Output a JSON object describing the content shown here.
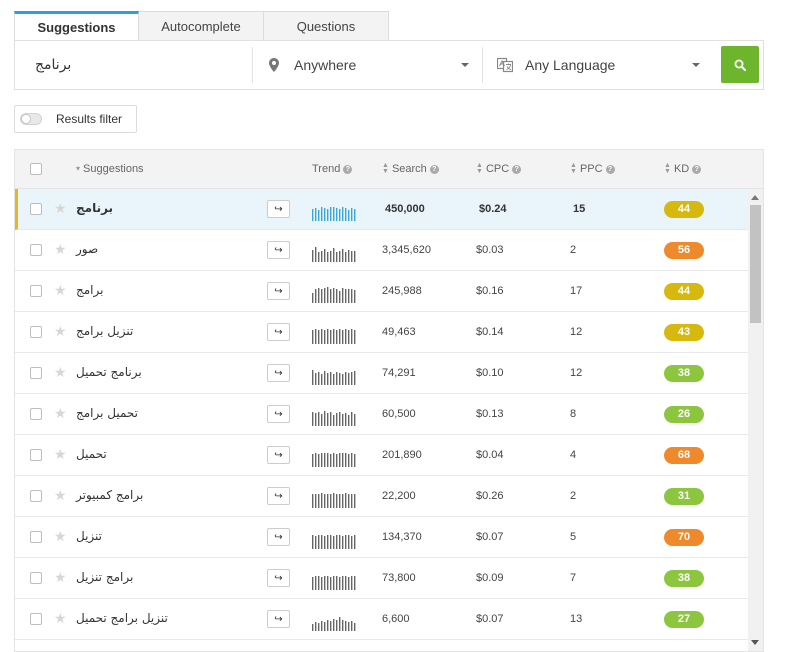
{
  "tabs": [
    {
      "label": "Suggestions",
      "active": true
    },
    {
      "label": "Autocomplete",
      "active": false
    },
    {
      "label": "Questions",
      "active": false
    }
  ],
  "search": {
    "keyword": "برنامج",
    "location": "Anywhere",
    "language": "Any Language",
    "submit_icon": "search-icon"
  },
  "filter": {
    "label": "Results filter",
    "enabled": false
  },
  "table": {
    "headers": {
      "keyword": "Suggestions",
      "trend": "Trend",
      "search": "Search",
      "cpc": "CPC",
      "ppc": "PPC",
      "kd": "KD"
    },
    "rows": [
      {
        "keyword": "برنامج",
        "search": "450,000",
        "cpc": "$0.24",
        "ppc": "15",
        "kd": "44",
        "kd_color": "#d7b80f",
        "selected": true,
        "trend_color": "#3aa7d9",
        "trend": [
          0.75,
          0.8,
          0.7,
          0.85,
          0.8,
          0.75,
          0.9,
          0.85,
          0.8,
          0.75,
          0.85,
          0.8,
          0.7,
          0.8,
          0.75
        ]
      },
      {
        "keyword": "صور",
        "search": "3,345,620",
        "cpc": "$0.03",
        "ppc": "2",
        "kd": "56",
        "kd_color": "#ee8a2c",
        "selected": false,
        "trend_color": "#666666",
        "trend": [
          0.75,
          0.95,
          0.6,
          0.7,
          0.8,
          0.65,
          0.7,
          0.85,
          0.65,
          0.7,
          0.8,
          0.6,
          0.75,
          0.7,
          0.7
        ]
      },
      {
        "keyword": "برامج",
        "search": "245,988",
        "cpc": "$0.16",
        "ppc": "17",
        "kd": "44",
        "kd_color": "#d7b80f",
        "selected": false,
        "trend_color": "#666666",
        "trend": [
          0.6,
          0.85,
          0.95,
          0.9,
          0.95,
          1.0,
          0.85,
          0.95,
          0.9,
          0.75,
          0.95,
          0.9,
          0.85,
          0.9,
          0.8
        ]
      },
      {
        "keyword": "تنزيل برامج",
        "search": "49,463",
        "cpc": "$0.14",
        "ppc": "12",
        "kd": "43",
        "kd_color": "#d7b80f",
        "selected": false,
        "trend_color": "#666666",
        "trend": [
          0.9,
          0.95,
          0.9,
          0.95,
          0.9,
          0.95,
          0.9,
          0.95,
          0.9,
          0.95,
          0.9,
          0.95,
          0.9,
          0.95,
          0.9
        ]
      },
      {
        "keyword": "برنامج تحميل",
        "search": "74,291",
        "cpc": "$0.10",
        "ppc": "12",
        "kd": "38",
        "kd_color": "#8cc63f",
        "selected": false,
        "trend_color": "#666666",
        "trend": [
          0.95,
          0.75,
          0.8,
          0.7,
          0.85,
          0.75,
          0.8,
          0.7,
          0.8,
          0.75,
          0.7,
          0.8,
          0.75,
          0.8,
          0.85
        ]
      },
      {
        "keyword": "تحميل برامج",
        "search": "60,500",
        "cpc": "$0.13",
        "ppc": "8",
        "kd": "26",
        "kd_color": "#8cc63f",
        "selected": false,
        "trend_color": "#666666",
        "trend": [
          0.9,
          0.8,
          0.85,
          0.75,
          0.95,
          0.8,
          0.85,
          0.7,
          0.8,
          0.85,
          0.75,
          0.8,
          0.7,
          0.85,
          0.75
        ]
      },
      {
        "keyword": "تحميل",
        "search": "201,890",
        "cpc": "$0.04",
        "ppc": "4",
        "kd": "68",
        "kd_color": "#ee8a2c",
        "selected": false,
        "trend_color": "#666666",
        "trend": [
          0.8,
          0.85,
          0.8,
          0.85,
          0.9,
          0.85,
          0.8,
          0.85,
          0.8,
          0.85,
          0.9,
          0.85,
          0.8,
          0.85,
          0.8
        ]
      },
      {
        "keyword": "برامج كمبيوتر",
        "search": "22,200",
        "cpc": "$0.26",
        "ppc": "2",
        "kd": "31",
        "kd_color": "#8cc63f",
        "selected": false,
        "trend_color": "#666666",
        "trend": [
          0.85,
          0.9,
          0.85,
          0.95,
          0.85,
          0.9,
          0.85,
          0.95,
          0.85,
          0.9,
          0.85,
          0.95,
          0.85,
          0.9,
          0.85
        ]
      },
      {
        "keyword": "تنزيل",
        "search": "134,370",
        "cpc": "$0.07",
        "ppc": "5",
        "kd": "70",
        "kd_color": "#ee8a2c",
        "selected": false,
        "trend_color": "#666666",
        "trend": [
          0.85,
          0.8,
          0.9,
          0.85,
          0.8,
          0.9,
          0.85,
          0.8,
          0.9,
          0.85,
          0.8,
          0.9,
          0.85,
          0.8,
          0.9
        ]
      },
      {
        "keyword": "برامج تنزيل",
        "search": "73,800",
        "cpc": "$0.09",
        "ppc": "7",
        "kd": "38",
        "kd_color": "#8cc63f",
        "selected": false,
        "trend_color": "#666666",
        "trend": [
          0.8,
          0.9,
          0.85,
          0.8,
          0.9,
          0.85,
          0.8,
          0.9,
          0.85,
          0.8,
          0.9,
          0.85,
          0.8,
          0.9,
          0.85
        ]
      },
      {
        "keyword": "تنزيل برامج تحميل",
        "search": "6,600",
        "cpc": "$0.07",
        "ppc": "13",
        "kd": "27",
        "kd_color": "#8cc63f",
        "selected": false,
        "trend_color": "#666666",
        "trend": [
          0.45,
          0.55,
          0.5,
          0.6,
          0.55,
          0.7,
          0.65,
          0.75,
          0.7,
          0.85,
          0.7,
          0.65,
          0.55,
          0.6,
          0.5
        ]
      }
    ]
  }
}
